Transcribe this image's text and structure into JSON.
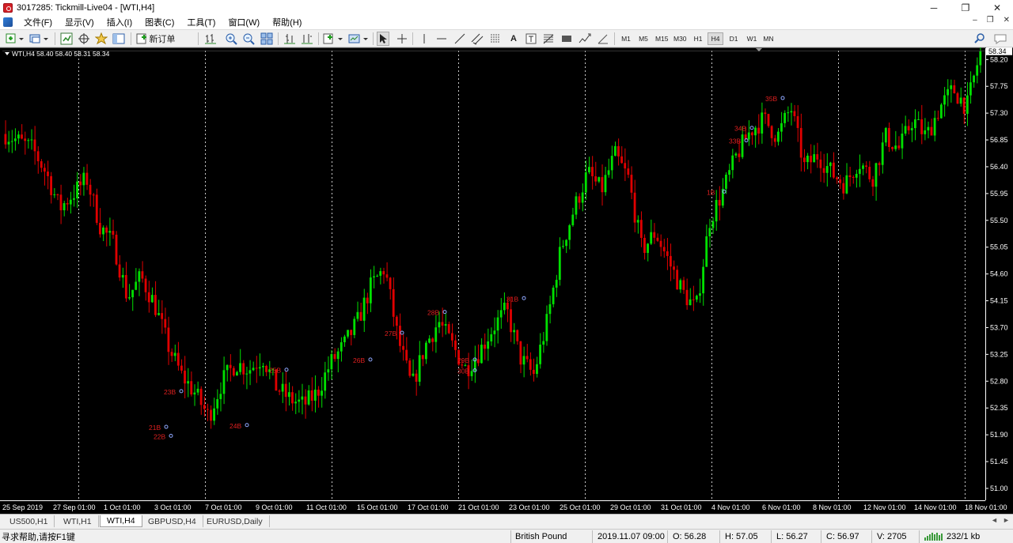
{
  "window": {
    "title": "3017285: Tickmill-Live04 - [WTI,H4]",
    "controls": {
      "minimize": "─",
      "maximize": "❐",
      "close": "✕"
    }
  },
  "menu": {
    "items": [
      "文件(F)",
      "显示(V)",
      "插入(I)",
      "图表(C)",
      "工具(T)",
      "窗口(W)",
      "帮助(H)"
    ],
    "mdi": {
      "minimize": "–",
      "restore": "❐",
      "close": "✕"
    }
  },
  "toolbar": {
    "new_order_label": "新订单",
    "text_tool": "A",
    "timeframes": [
      "M1",
      "M5",
      "M15",
      "M30",
      "H1",
      "H4",
      "D1",
      "W1",
      "MN"
    ],
    "active_timeframe": "H4"
  },
  "chart": {
    "header": "WTI,H4  58.40 58.40 58.31 58.34",
    "current_price": "58.34",
    "colors": {
      "background": "#000000",
      "bull": "#00e000",
      "bear": "#e00000",
      "grid": "#c8c8c8",
      "axis_text": "#ffffff",
      "marker_text": "#e02020",
      "price_tag_bg": "#ffffff"
    }
  },
  "chart_data": {
    "type": "candlestick",
    "symbol": "WTI",
    "timeframe": "H4",
    "ylim": [
      50.8,
      58.35
    ],
    "y_ticks": [
      "58.20",
      "57.75",
      "57.30",
      "56.85",
      "56.40",
      "55.95",
      "55.50",
      "55.05",
      "54.60",
      "54.15",
      "53.70",
      "53.25",
      "52.80",
      "52.35",
      "51.90",
      "51.45",
      "51.00"
    ],
    "x_ticks": [
      "25 Sep 2019",
      "27 Sep 01:00",
      "1 Oct 01:00",
      "3 Oct 01:00",
      "7 Oct 01:00",
      "9 Oct 01:00",
      "11 Oct 01:00",
      "15 Oct 01:00",
      "17 Oct 01:00",
      "21 Oct 01:00",
      "23 Oct 01:00",
      "25 Oct 01:00",
      "29 Oct 01:00",
      "31 Oct 01:00",
      "4 Nov 01:00",
      "6 Nov 01:00",
      "8 Nov 01:00",
      "12 Nov 01:00",
      "14 Nov 01:00",
      "18 Nov 01:00"
    ],
    "close_path": [
      [
        0,
        56.95
      ],
      [
        4,
        56.7
      ],
      [
        6,
        56.3
      ],
      [
        8,
        55.7
      ],
      [
        10,
        55.95
      ],
      [
        12,
        56.2
      ],
      [
        14,
        55.4
      ],
      [
        16,
        55.1
      ],
      [
        18,
        54.2
      ],
      [
        20,
        54.55
      ],
      [
        22,
        54.1
      ],
      [
        24,
        53.4
      ],
      [
        26,
        52.9
      ],
      [
        28,
        52.6
      ],
      [
        30,
        52.2
      ],
      [
        32,
        52.8
      ],
      [
        34,
        53.1
      ],
      [
        36,
        53.0
      ],
      [
        38,
        53.2
      ],
      [
        40,
        52.7
      ],
      [
        42,
        52.5
      ],
      [
        44,
        52.4
      ],
      [
        46,
        52.6
      ],
      [
        48,
        53.1
      ],
      [
        50,
        53.4
      ],
      [
        52,
        53.8
      ],
      [
        54,
        54.4
      ],
      [
        56,
        54.7
      ],
      [
        58,
        53.5
      ],
      [
        60,
        52.7
      ],
      [
        62,
        53.4
      ],
      [
        64,
        53.8
      ],
      [
        66,
        53.4
      ],
      [
        68,
        53.0
      ],
      [
        70,
        53.3
      ],
      [
        72,
        53.7
      ],
      [
        74,
        54.0
      ],
      [
        76,
        53.2
      ],
      [
        78,
        52.9
      ],
      [
        80,
        53.8
      ],
      [
        82,
        55.0
      ],
      [
        84,
        55.7
      ],
      [
        86,
        56.3
      ],
      [
        88,
        56.0
      ],
      [
        90,
        56.6
      ],
      [
        92,
        56.2
      ],
      [
        94,
        55.0
      ],
      [
        96,
        55.3
      ],
      [
        98,
        54.8
      ],
      [
        100,
        54.3
      ],
      [
        102,
        54.0
      ],
      [
        104,
        55.5
      ],
      [
        106,
        56.0
      ],
      [
        108,
        56.6
      ],
      [
        110,
        57.0
      ],
      [
        112,
        57.2
      ],
      [
        114,
        56.9
      ],
      [
        116,
        57.4
      ],
      [
        118,
        56.4
      ],
      [
        120,
        56.6
      ],
      [
        122,
        56.3
      ],
      [
        124,
        56.1
      ],
      [
        126,
        56.5
      ],
      [
        128,
        56.2
      ],
      [
        130,
        56.9
      ],
      [
        132,
        56.7
      ],
      [
        134,
        57.2
      ],
      [
        136,
        56.9
      ],
      [
        138,
        57.4
      ],
      [
        140,
        57.7
      ],
      [
        142,
        57.4
      ],
      [
        144,
        58.34
      ]
    ],
    "trade_markers": [
      {
        "label": "21B",
        "price": 52.02
      },
      {
        "label": "22B",
        "price": 51.87
      },
      {
        "label": "23B",
        "price": 52.62
      },
      {
        "label": "24B",
        "price": 52.05
      },
      {
        "label": "25B",
        "price": 52.98
      },
      {
        "label": "26B",
        "price": 53.15
      },
      {
        "label": "27B",
        "price": 53.6
      },
      {
        "label": "28B",
        "price": 53.95
      },
      {
        "label": "29B",
        "price": 53.15
      },
      {
        "label": "30B",
        "price": 52.97
      },
      {
        "label": "31B",
        "price": 54.18
      },
      {
        "label": "33B",
        "price": 56.83
      },
      {
        "label": "34B",
        "price": 57.04
      },
      {
        "label": "35B",
        "price": 57.54
      },
      {
        "label": "1B",
        "price": 55.97
      }
    ]
  },
  "tabs": {
    "items": [
      "US500,H1",
      "WTI,H1",
      "WTI,H4",
      "GBPUSD,H4",
      "EURUSD,Daily"
    ],
    "active": "WTI,H4",
    "nav_left": "◄",
    "nav_right": "►"
  },
  "statusbar": {
    "help": "寻求帮助,请按F1键",
    "profile": "British Pound",
    "datetime": "2019.11.07 09:00",
    "open": "O: 56.28",
    "high": "H: 57.05",
    "low": "L: 56.27",
    "close": "C: 56.97",
    "volume": "V: 2705",
    "traffic": "232/1 kb"
  }
}
